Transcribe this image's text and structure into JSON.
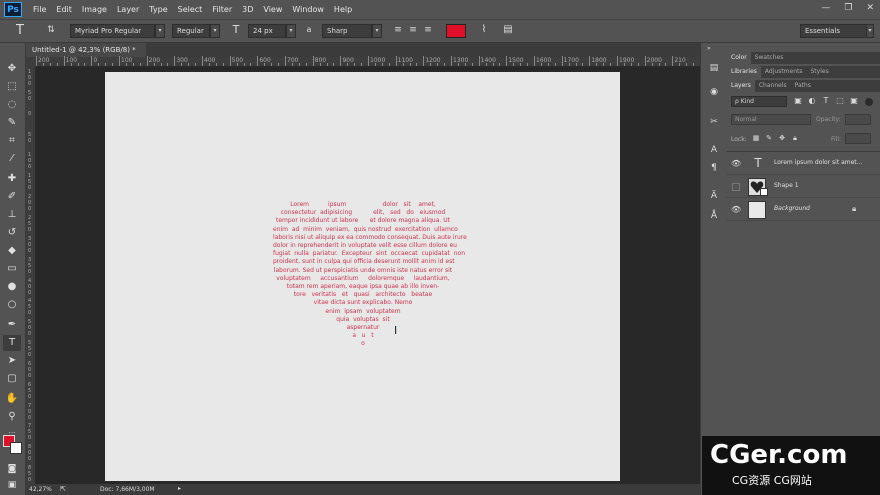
{
  "menubar": {
    "logo": "Ps",
    "items": [
      "File",
      "Edit",
      "Image",
      "Layer",
      "Type",
      "Select",
      "Filter",
      "3D",
      "View",
      "Window",
      "Help"
    ]
  },
  "options": {
    "font_family": "Myriad Pro Regular",
    "font_style": "Regular",
    "font_size": "24 px",
    "antialias_label": "a",
    "antialias": "Sharp",
    "text_color": "#e0102a",
    "workspace": "Essentials"
  },
  "document": {
    "tab_title": "Untitled-1 @ 42,3% (RGB/8) *",
    "close": "×"
  },
  "ruler_top_labels": [
    "200",
    "100",
    "0",
    "100",
    "200",
    "300",
    "400",
    "500",
    "600",
    "700",
    "800",
    "900",
    "1000",
    "1100",
    "1200",
    "1300",
    "1400",
    "1500",
    "1600",
    "1700",
    "1800",
    "1900",
    "2000",
    "210"
  ],
  "ruler_left_labels": [
    "1\n0\n0",
    "5\n0",
    "0",
    "5\n0",
    "1\n0\n0",
    "1\n5\n0",
    "2\n0\n0",
    "2\n5\n0",
    "3\n0\n0",
    "3\n5\n0",
    "4\n0\n0",
    "4\n5\n0",
    "5\n0\n0",
    "5\n5\n0",
    "6\n0\n0",
    "6\n5\n0",
    "7\n0\n0",
    "7\n5\n0",
    "8\n0\n0",
    "8\n5\n0"
  ],
  "heart_text": "Lorem          ipsum                   dolor   sit    amet,\nconsectetur  adipisicing           elit,   sed   do   eiusmod\ntempor incididunt ut labore      et dolore magna aliqua. Ut\nenim  ad  minim  veniam,  quis nostrud  exercitation  ullamco\nlaboris nisi ut aliquip ex ea commodo consequat. Duis aute irure\ndolor in reprehenderit in voluptate velit esse cillum dolore eu\nfugiat  nulla  pariatur.  Excepteur  sint  occaecat  cupidatat  non\nproident, sunt in culpa qui officia deserunt mollit anim id est\nlaborum. Sed ut perspiciatis unde omnis iste natus error sit\nvoluptatem     accusantium     doloremque     laudantium,\ntotam rem aperiam, eaque ipsa quae ab illo inven-\ntore   veritatis   et   quasi   architecto   beatae\nvitae dicta sunt explicabo. Nemo\nenim  ipsam  voluptatem\nquia  voluptas  sit\naspernatur\na   u   t\no",
  "status": {
    "zoom": "42,27%",
    "doc": "Doc: 7,66M/3,00M"
  },
  "panels": {
    "top_tabs": [
      "Color",
      "Swatches"
    ],
    "mid_tabs": [
      "Libraries",
      "Adjustments",
      "Styles"
    ],
    "layers_tabs": [
      "Layers",
      "Channels",
      "Paths"
    ],
    "kind": "ρ Kind",
    "blend_mode": "Normal",
    "opacity_label": "Opacity:",
    "lock_label": "Lock:",
    "fill_label": "Fill:",
    "layers": [
      {
        "name": "Lorem ipsum dolor sit amet...",
        "kind": "text"
      },
      {
        "name": "Shape 1",
        "kind": "shape"
      },
      {
        "name": "Background",
        "kind": "background"
      }
    ]
  },
  "watermark": {
    "big": "CGer.com",
    "small": "CG资源 CG网站"
  }
}
